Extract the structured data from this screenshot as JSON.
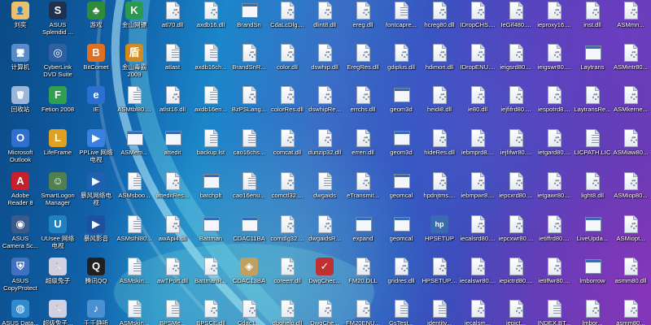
{
  "desktop": {
    "columns": [
      [
        {
          "label": "刘奕",
          "icon": "user-folder-icon"
        },
        {
          "label": "计算机",
          "icon": "computer-icon"
        },
        {
          "label": "回收站",
          "icon": "recycle-bin-icon"
        },
        {
          "label": "Microsoft\nOutlook",
          "icon": "outlook-icon"
        },
        {
          "label": "Adobe\nReader 8",
          "icon": "adobe-reader-icon"
        },
        {
          "label": "ASUS\nCamera Sc...",
          "icon": "camera-icon"
        },
        {
          "label": "ASUS\nCopyProtect",
          "icon": "shield-icon"
        },
        {
          "label": "ASUS Data...",
          "icon": "globe-icon"
        }
      ],
      [
        {
          "label": "ASUS\nSplendid ...",
          "icon": "asus-splendid-icon"
        },
        {
          "label": "CyberLink\nDVD Suite",
          "icon": "dvd-icon"
        },
        {
          "label": "Fetion 2008",
          "icon": "fetion-icon"
        },
        {
          "label": "LifeFrame",
          "icon": "lifeframe-icon"
        },
        {
          "label": "SmartLogon\nManager",
          "icon": "smartlogon-icon"
        },
        {
          "label": "UUsee 网络\n电视",
          "icon": "uusee-icon"
        },
        {
          "label": "超级兔子",
          "icon": "rabbit-icon"
        },
        {
          "label": "超级兔子...",
          "icon": "rabbit-icon"
        }
      ],
      [
        {
          "label": "游戏",
          "icon": "tree-icon"
        },
        {
          "label": "BitComet",
          "icon": "bitcomet-icon"
        },
        {
          "label": "IE",
          "icon": "ie-icon"
        },
        {
          "label": "PPLive 网络\n电视",
          "icon": "pplive-icon"
        },
        {
          "label": "暴风网络电\n视",
          "icon": "storm-icon"
        },
        {
          "label": "暴风影音",
          "icon": "storm-player-icon"
        },
        {
          "label": "腾讯QQ",
          "icon": "qq-icon"
        },
        {
          "label": "千千静听",
          "icon": "music-icon"
        }
      ],
      [
        {
          "label": "金山网镖",
          "icon": "kingsoft-icon"
        },
        {
          "label": "金山毒霸\n2009",
          "icon": "antivirus-icon"
        },
        {
          "label": "ASMtbl80....",
          "icon": "file-icon"
        },
        {
          "label": "ASMem...",
          "icon": "exe-icon"
        },
        {
          "label": "ASMsboo...",
          "icon": "file-icon"
        },
        {
          "label": "ASMsIhl80...",
          "icon": "file-icon"
        },
        {
          "label": "ASMskin...",
          "icon": "file-icon"
        },
        {
          "label": "ASMskin...",
          "icon": "file-icon"
        }
      ],
      [
        {
          "label": "atl70.dll",
          "icon": "dll-icon"
        },
        {
          "label": "atlast",
          "icon": "file-icon"
        },
        {
          "label": "atlst16.dll",
          "icon": "dll-icon"
        },
        {
          "label": "attedit",
          "icon": "exe-icon"
        },
        {
          "label": "atteditRes...",
          "icon": "dll-icon"
        },
        {
          "label": "awApi4.dll",
          "icon": "dll-icon"
        },
        {
          "label": "awTPort.dll",
          "icon": "dll-icon"
        },
        {
          "label": "BPSMe...",
          "icon": "file-icon"
        }
      ],
      [
        {
          "label": "axdb16.dll",
          "icon": "dll-icon"
        },
        {
          "label": "axdb16ch...",
          "icon": "file-icon"
        },
        {
          "label": "axdb16en...",
          "icon": "file-icon"
        },
        {
          "label": "backup.lst",
          "icon": "file-icon"
        },
        {
          "label": "batchplt",
          "icon": "exe-icon"
        },
        {
          "label": "Battman",
          "icon": "exe-icon"
        },
        {
          "label": "BattmanR...",
          "icon": "dll-icon"
        },
        {
          "label": "BPSCE.dll",
          "icon": "dll-icon"
        }
      ],
      [
        {
          "label": "BrandSn",
          "icon": "exe-icon"
        },
        {
          "label": "BrandSnR...",
          "icon": "dll-icon"
        },
        {
          "label": "BzPSLang...",
          "icon": "dll-icon"
        },
        {
          "label": "cao16chs...",
          "icon": "file-icon"
        },
        {
          "label": "cao16enu...",
          "icon": "file-icon"
        },
        {
          "label": "CDAC11BA",
          "icon": "exe-icon"
        },
        {
          "label": "CDAC13BA",
          "icon": "cdac-icon"
        },
        {
          "label": "Cdac1...",
          "icon": "dll-icon"
        }
      ],
      [
        {
          "label": "CdaLcDlg....",
          "icon": "dll-icon"
        },
        {
          "label": "color.dll",
          "icon": "dll-icon"
        },
        {
          "label": "colorRes.dll",
          "icon": "dll-icon"
        },
        {
          "label": "comcat.dll",
          "icon": "dll-icon"
        },
        {
          "label": "comctl32....",
          "icon": "dll-icon"
        },
        {
          "label": "comdlg32....",
          "icon": "dll-icon"
        },
        {
          "label": "coreerr.dll",
          "icon": "dll-icon"
        },
        {
          "label": "dbghelp.dll",
          "icon": "dll-icon"
        }
      ],
      [
        {
          "label": "dlint8.dll",
          "icon": "dll-icon"
        },
        {
          "label": "dswhip.dll",
          "icon": "dll-icon"
        },
        {
          "label": "dswhipRe...",
          "icon": "dll-icon"
        },
        {
          "label": "dunzip32.dll",
          "icon": "dll-icon"
        },
        {
          "label": "dwgaids",
          "icon": "file-icon"
        },
        {
          "label": "dwgaidsR...",
          "icon": "dll-icon"
        },
        {
          "label": "DwgChec...",
          "icon": "dwgcheck-icon"
        },
        {
          "label": "DwgChe...",
          "icon": "dll-icon"
        }
      ],
      [
        {
          "label": "ereg.dll",
          "icon": "dll-icon"
        },
        {
          "label": "EregRes.dll",
          "icon": "dll-icon"
        },
        {
          "label": "errchs.dll",
          "icon": "dll-icon"
        },
        {
          "label": "erren.dll",
          "icon": "dll-icon"
        },
        {
          "label": "eTransmit...",
          "icon": "dll-icon"
        },
        {
          "label": "expand",
          "icon": "exe-icon"
        },
        {
          "label": "FM20.DLL",
          "icon": "dll-icon"
        },
        {
          "label": "FM20ENU...",
          "icon": "dll-icon"
        }
      ],
      [
        {
          "label": "fontcapre...",
          "icon": "file-icon"
        },
        {
          "label": "gdiplus.dll",
          "icon": "dll-icon"
        },
        {
          "label": "geom3d",
          "icon": "exe-icon"
        },
        {
          "label": "geom3d",
          "icon": "exe-icon"
        },
        {
          "label": "geomcal",
          "icon": "exe-icon"
        },
        {
          "label": "geomcal",
          "icon": "exe-icon"
        },
        {
          "label": "gridres.dll",
          "icon": "dll-icon"
        },
        {
          "label": "GsTest...",
          "icon": "file-icon"
        }
      ],
      [
        {
          "label": "hcreg80.dll",
          "icon": "dll-icon"
        },
        {
          "label": "hdimon.dll",
          "icon": "dll-icon"
        },
        {
          "label": "heidi8.dll",
          "icon": "dll-icon"
        },
        {
          "label": "hideRes.dll",
          "icon": "dll-icon"
        },
        {
          "label": "hpdnjtms....",
          "icon": "dll-icon"
        },
        {
          "label": "HPSETUP",
          "icon": "hp-icon"
        },
        {
          "label": "HPSETUP....",
          "icon": "dll-icon"
        },
        {
          "label": "identity...",
          "icon": "file-icon"
        }
      ],
      [
        {
          "label": "IDropCHS....",
          "icon": "dll-icon"
        },
        {
          "label": "IDropENU....",
          "icon": "dll-icon"
        },
        {
          "label": "ie80.dll",
          "icon": "dll-icon"
        },
        {
          "label": "iebmprd8....",
          "icon": "dll-icon"
        },
        {
          "label": "iebmpwr8....",
          "icon": "dll-icon"
        },
        {
          "label": "iecalsrd80....",
          "icon": "dll-icon"
        },
        {
          "label": "iecalswr80....",
          "icon": "dll-icon"
        },
        {
          "label": "iecalsm...",
          "icon": "dll-icon"
        }
      ],
      [
        {
          "label": "IeGif480....",
          "icon": "dll-icon"
        },
        {
          "label": "ieigsrd80....",
          "icon": "dll-icon"
        },
        {
          "label": "iejfifrd80....",
          "icon": "dll-icon"
        },
        {
          "label": "iejfifwr80....",
          "icon": "dll-icon"
        },
        {
          "label": "iepcxrd80....",
          "icon": "dll-icon"
        },
        {
          "label": "iepcxwr80....",
          "icon": "dll-icon"
        },
        {
          "label": "iepictrd80....",
          "icon": "dll-icon"
        },
        {
          "label": "iepict...",
          "icon": "dll-icon"
        }
      ],
      [
        {
          "label": "ieproxy16....",
          "icon": "dll-icon"
        },
        {
          "label": "ieigswr80....",
          "icon": "dll-icon"
        },
        {
          "label": "iespotrd8....",
          "icon": "dll-icon"
        },
        {
          "label": "ietgard80....",
          "icon": "dll-icon"
        },
        {
          "label": "ietgawr80....",
          "icon": "dll-icon"
        },
        {
          "label": "ietiffrd80....",
          "icon": "dll-icon"
        },
        {
          "label": "ietiffwr80....",
          "icon": "dll-icon"
        },
        {
          "label": "INDEX.BT...",
          "icon": "file-icon"
        }
      ],
      [
        {
          "label": "inst.dll",
          "icon": "dll-icon"
        },
        {
          "label": "Laytrans",
          "icon": "exe-icon"
        },
        {
          "label": "LaytransRe...",
          "icon": "dll-icon"
        },
        {
          "label": "LICPATH.LIC",
          "icon": "file-icon"
        },
        {
          "label": "light8.dll",
          "icon": "dll-icon"
        },
        {
          "label": "LiveUpda...",
          "icon": "exe-icon"
        },
        {
          "label": "lmborrow",
          "icon": "exe-icon"
        },
        {
          "label": "lmbor...",
          "icon": "dll-icon"
        }
      ],
      [
        {
          "label": "ASMmn...",
          "icon": "dll-icon"
        },
        {
          "label": "ASMintr80...",
          "icon": "dll-icon"
        },
        {
          "label": "ASMkerne...",
          "icon": "dll-icon"
        },
        {
          "label": "ASMiaw80...",
          "icon": "dll-icon"
        },
        {
          "label": "ASMiop80...",
          "icon": "dll-icon"
        },
        {
          "label": "ASMiopt...",
          "icon": "dll-icon"
        },
        {
          "label": "asmm80.dll",
          "icon": "dll-icon"
        },
        {
          "label": "asmm80...",
          "icon": "dll-icon"
        }
      ]
    ]
  }
}
